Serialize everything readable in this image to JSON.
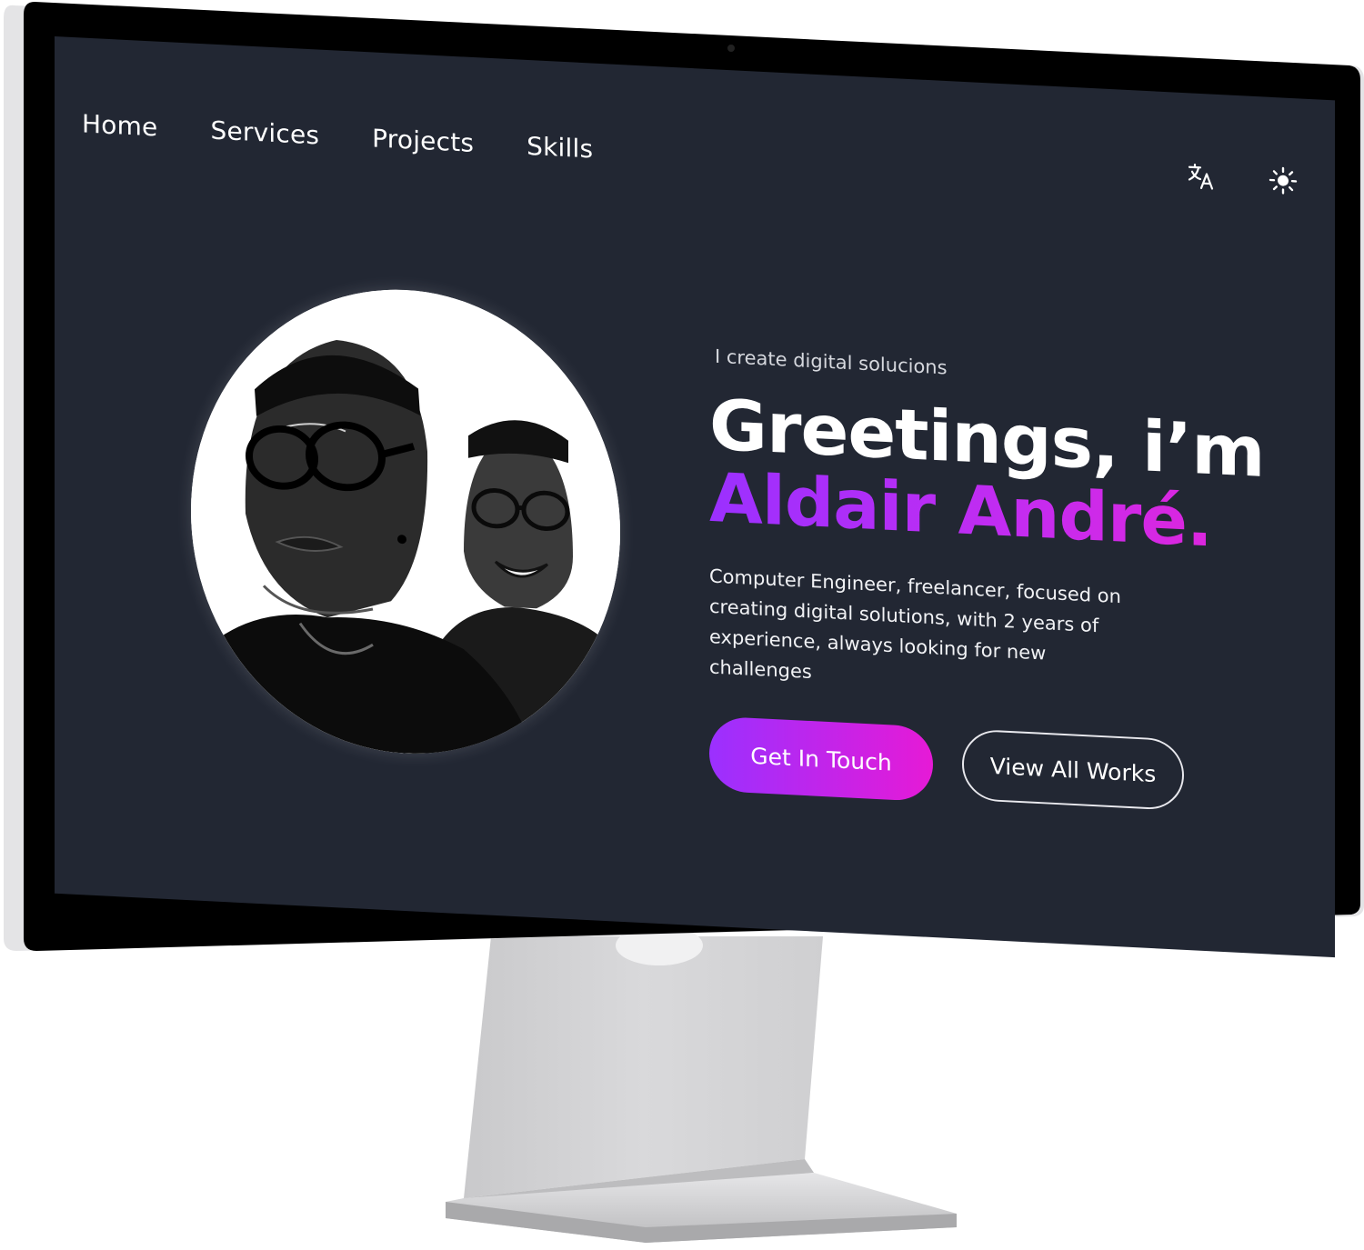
{
  "nav": {
    "items": [
      {
        "label": "Home"
      },
      {
        "label": "Services"
      },
      {
        "label": "Projects"
      },
      {
        "label": "Skills"
      }
    ]
  },
  "toolbar": {
    "translate_icon": "translate-icon",
    "theme_icon": "sun-icon"
  },
  "hero": {
    "eyebrow": "I create digital solucions",
    "greeting": "Greetings, i’m",
    "name": "Aldair André.",
    "bio": "Computer Engineer, freelancer, focused on creating digital solutions, with 2 years of experience, always looking for new challenges",
    "primary_cta": "Get In Touch",
    "secondary_cta": "View All Works"
  },
  "colors": {
    "background": "#222733",
    "accent_start": "#9b30ff",
    "accent_end": "#e61ad6",
    "text": "#ffffff"
  }
}
